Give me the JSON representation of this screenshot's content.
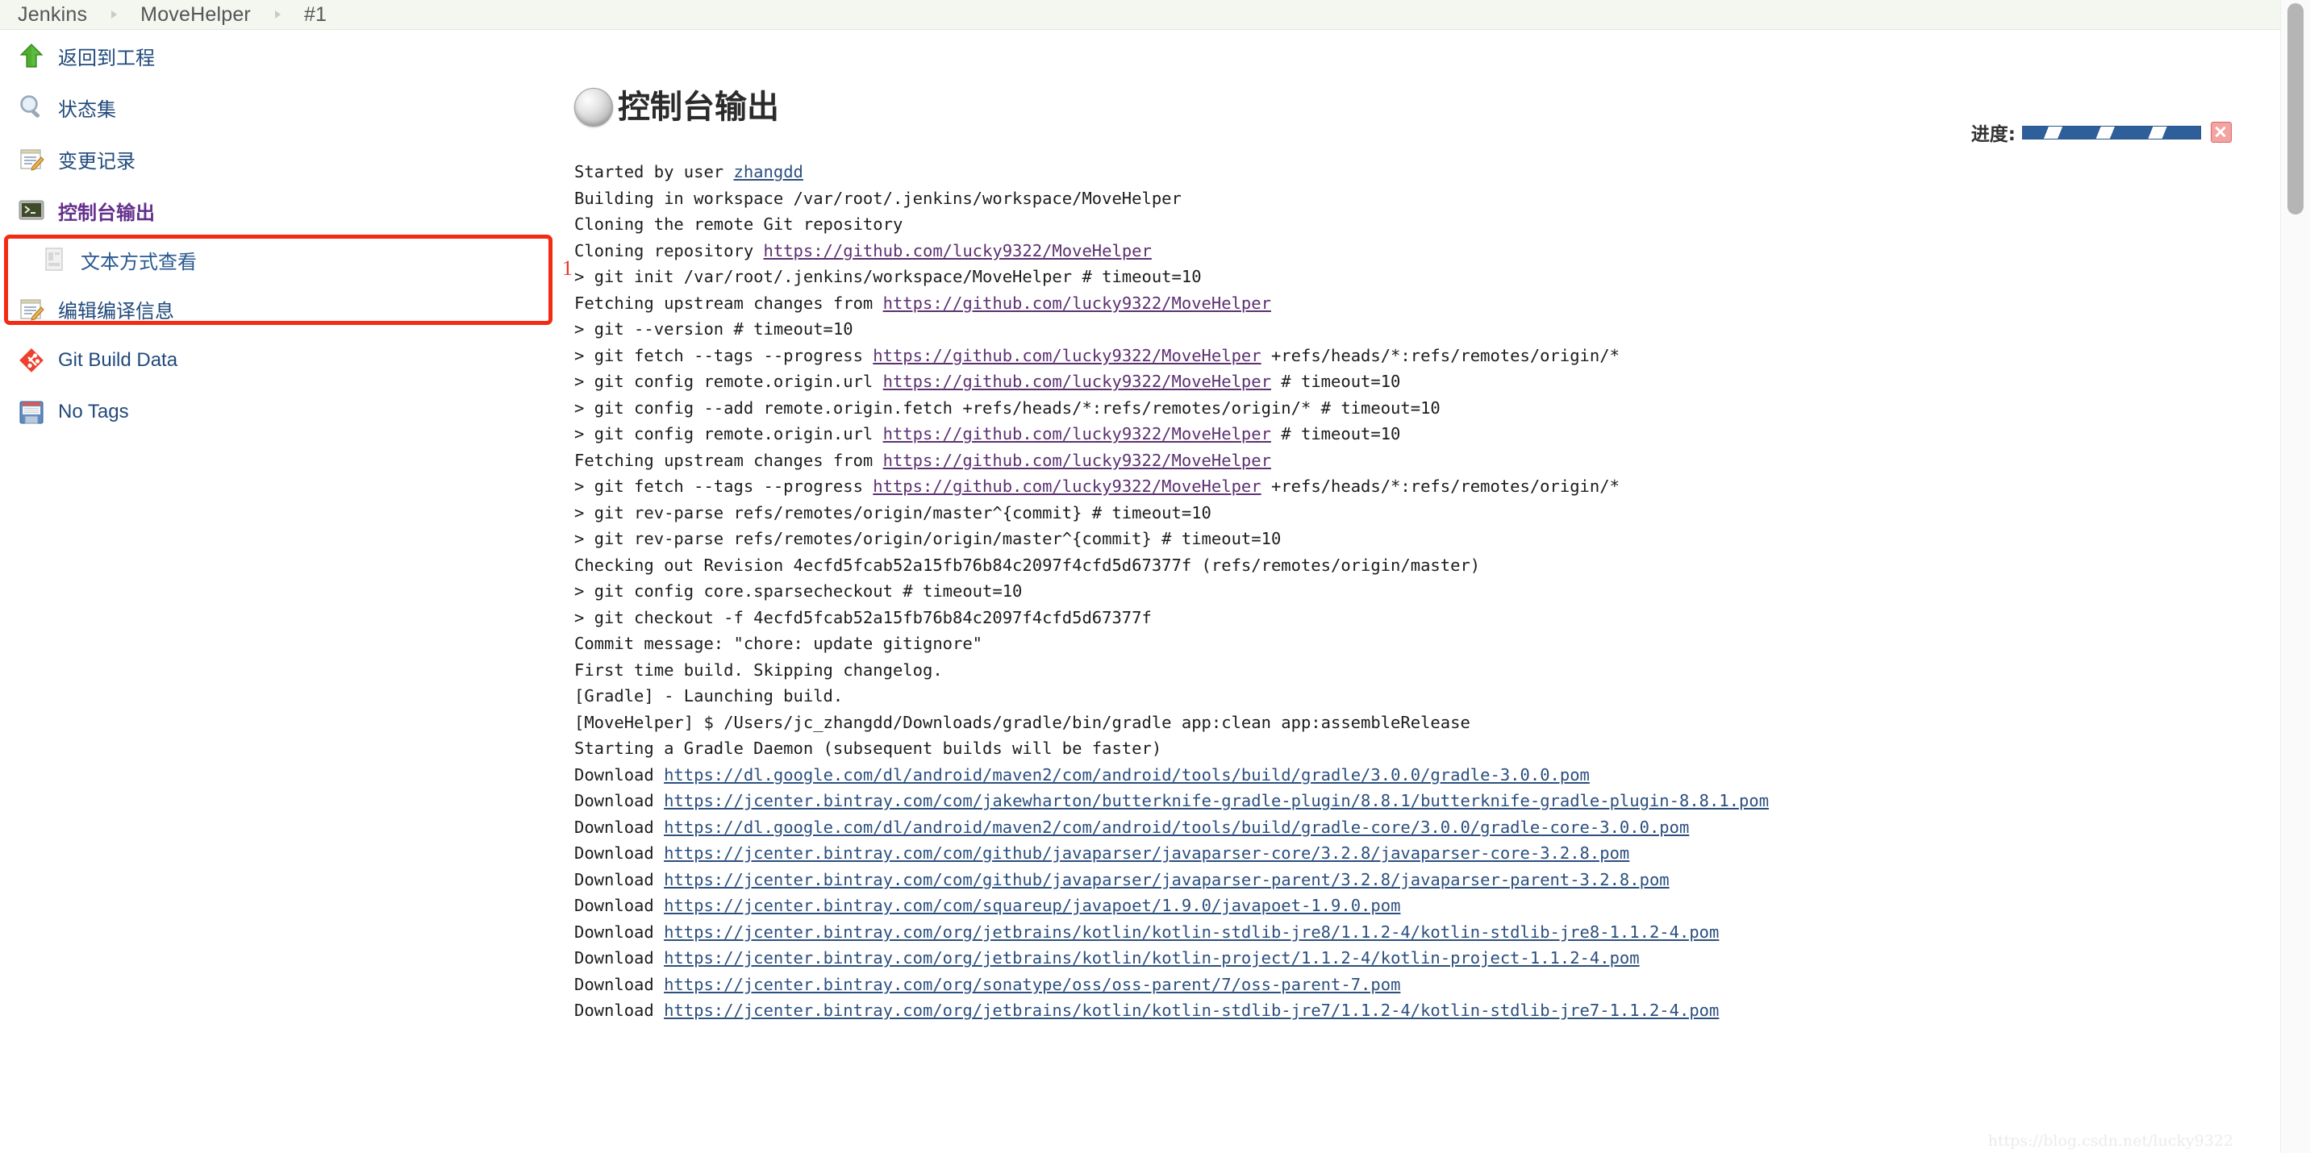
{
  "breadcrumb": {
    "items": [
      "Jenkins",
      "MoveHelper",
      "#1"
    ]
  },
  "sidebar": {
    "items": [
      {
        "label": "返回到工程",
        "icon": "up-arrow-icon",
        "style": "link"
      },
      {
        "label": "状态集",
        "icon": "magnifier-icon",
        "style": "link"
      },
      {
        "label": "变更记录",
        "icon": "notepad-pencil-icon",
        "style": "link"
      },
      {
        "label": "控制台输出",
        "icon": "terminal-icon",
        "style": "visited"
      },
      {
        "label": "文本方式查看",
        "icon": "document-icon",
        "style": "sub"
      },
      {
        "label": "编辑编译信息",
        "icon": "notepad-pencil-icon",
        "style": "link"
      },
      {
        "label": "Git Build Data",
        "icon": "git-icon",
        "style": "link"
      },
      {
        "label": "No Tags",
        "icon": "floppy-disk-icon",
        "style": "link"
      }
    ],
    "annotation_number": "1",
    "annotation_color": "#f32b12"
  },
  "main": {
    "title": "控制台输出",
    "status_icon": "grey-ball-in-progress-icon",
    "progress_label": "进度:",
    "progress_percent": 100,
    "progress_color": "#2e5f9a",
    "cancel_button_label": "×",
    "annotation_number": "1"
  },
  "console": {
    "lines": [
      {
        "segments": [
          {
            "t": "Started by user "
          },
          {
            "t": "zhangdd",
            "link": true,
            "visited": false
          }
        ]
      },
      {
        "segments": [
          {
            "t": "Building in workspace /var/root/.jenkins/workspace/MoveHelper"
          }
        ]
      },
      {
        "segments": [
          {
            "t": "Cloning the remote Git repository"
          }
        ]
      },
      {
        "segments": [
          {
            "t": "Cloning repository "
          },
          {
            "t": "https://github.com/lucky9322/MoveHelper",
            "link": true,
            "visited": true
          }
        ]
      },
      {
        "segments": [
          {
            "t": " > git init /var/root/.jenkins/workspace/MoveHelper # timeout=10"
          }
        ]
      },
      {
        "segments": [
          {
            "t": "Fetching upstream changes from "
          },
          {
            "t": "https://github.com/lucky9322/MoveHelper",
            "link": true,
            "visited": true
          }
        ]
      },
      {
        "segments": [
          {
            "t": " > git --version # timeout=10"
          }
        ]
      },
      {
        "segments": [
          {
            "t": " > git fetch --tags --progress "
          },
          {
            "t": "https://github.com/lucky9322/MoveHelper",
            "link": true,
            "visited": true
          },
          {
            "t": " +refs/heads/*:refs/remotes/origin/*"
          }
        ]
      },
      {
        "segments": [
          {
            "t": " > git config remote.origin.url "
          },
          {
            "t": "https://github.com/lucky9322/MoveHelper",
            "link": true,
            "visited": true
          },
          {
            "t": " # timeout=10"
          }
        ]
      },
      {
        "segments": [
          {
            "t": " > git config --add remote.origin.fetch +refs/heads/*:refs/remotes/origin/* # timeout=10"
          }
        ]
      },
      {
        "segments": [
          {
            "t": " > git config remote.origin.url "
          },
          {
            "t": "https://github.com/lucky9322/MoveHelper",
            "link": true,
            "visited": true
          },
          {
            "t": " # timeout=10"
          }
        ]
      },
      {
        "segments": [
          {
            "t": "Fetching upstream changes from "
          },
          {
            "t": "https://github.com/lucky9322/MoveHelper",
            "link": true,
            "visited": true
          }
        ]
      },
      {
        "segments": [
          {
            "t": " > git fetch --tags --progress "
          },
          {
            "t": "https://github.com/lucky9322/MoveHelper",
            "link": true,
            "visited": true
          },
          {
            "t": " +refs/heads/*:refs/remotes/origin/*"
          }
        ]
      },
      {
        "segments": [
          {
            "t": " > git rev-parse refs/remotes/origin/master^{commit} # timeout=10"
          }
        ]
      },
      {
        "segments": [
          {
            "t": " > git rev-parse refs/remotes/origin/origin/master^{commit} # timeout=10"
          }
        ]
      },
      {
        "segments": [
          {
            "t": "Checking out Revision 4ecfd5fcab52a15fb76b84c2097f4cfd5d67377f (refs/remotes/origin/master)"
          }
        ]
      },
      {
        "segments": [
          {
            "t": " > git config core.sparsecheckout # timeout=10"
          }
        ]
      },
      {
        "segments": [
          {
            "t": " > git checkout -f 4ecfd5fcab52a15fb76b84c2097f4cfd5d67377f"
          }
        ]
      },
      {
        "segments": [
          {
            "t": "Commit message: \"chore: update gitignore\""
          }
        ]
      },
      {
        "segments": [
          {
            "t": "First time build. Skipping changelog."
          }
        ]
      },
      {
        "segments": [
          {
            "t": "[Gradle] - Launching build."
          }
        ]
      },
      {
        "segments": [
          {
            "t": "[MoveHelper] $ /Users/jc_zhangdd/Downloads/gradle/bin/gradle app:clean app:assembleRelease"
          }
        ]
      },
      {
        "segments": [
          {
            "t": "Starting a Gradle Daemon (subsequent builds will be faster)"
          }
        ]
      },
      {
        "segments": [
          {
            "t": "Download "
          },
          {
            "t": "https://dl.google.com/dl/android/maven2/com/android/tools/build/gradle/3.0.0/gradle-3.0.0.pom",
            "link": true,
            "visited": false
          }
        ]
      },
      {
        "segments": [
          {
            "t": "Download "
          },
          {
            "t": "https://jcenter.bintray.com/com/jakewharton/butterknife-gradle-plugin/8.8.1/butterknife-gradle-plugin-8.8.1.pom",
            "link": true,
            "visited": false
          }
        ]
      },
      {
        "segments": [
          {
            "t": "Download "
          },
          {
            "t": "https://dl.google.com/dl/android/maven2/com/android/tools/build/gradle-core/3.0.0/gradle-core-3.0.0.pom",
            "link": true,
            "visited": false
          }
        ]
      },
      {
        "segments": [
          {
            "t": "Download "
          },
          {
            "t": "https://jcenter.bintray.com/com/github/javaparser/javaparser-core/3.2.8/javaparser-core-3.2.8.pom",
            "link": true,
            "visited": false
          }
        ]
      },
      {
        "segments": [
          {
            "t": "Download "
          },
          {
            "t": "https://jcenter.bintray.com/com/github/javaparser/javaparser-parent/3.2.8/javaparser-parent-3.2.8.pom",
            "link": true,
            "visited": false
          }
        ]
      },
      {
        "segments": [
          {
            "t": "Download "
          },
          {
            "t": "https://jcenter.bintray.com/com/squareup/javapoet/1.9.0/javapoet-1.9.0.pom",
            "link": true,
            "visited": false
          }
        ]
      },
      {
        "segments": [
          {
            "t": "Download "
          },
          {
            "t": "https://jcenter.bintray.com/org/jetbrains/kotlin/kotlin-stdlib-jre8/1.1.2-4/kotlin-stdlib-jre8-1.1.2-4.pom",
            "link": true,
            "visited": false
          }
        ]
      },
      {
        "segments": [
          {
            "t": "Download "
          },
          {
            "t": "https://jcenter.bintray.com/org/jetbrains/kotlin/kotlin-project/1.1.2-4/kotlin-project-1.1.2-4.pom",
            "link": true,
            "visited": false
          }
        ]
      },
      {
        "segments": [
          {
            "t": "Download "
          },
          {
            "t": "https://jcenter.bintray.com/org/sonatype/oss/oss-parent/7/oss-parent-7.pom",
            "link": true,
            "visited": false
          }
        ]
      },
      {
        "segments": [
          {
            "t": "Download "
          },
          {
            "t": "https://jcenter.bintray.com/org/jetbrains/kotlin/kotlin-stdlib-jre7/1.1.2-4/kotlin-stdlib-jre7-1.1.2-4.pom",
            "link": true,
            "visited": false
          }
        ]
      }
    ]
  },
  "watermark": {
    "text": "https://blog.csdn.net/lucky9322"
  }
}
